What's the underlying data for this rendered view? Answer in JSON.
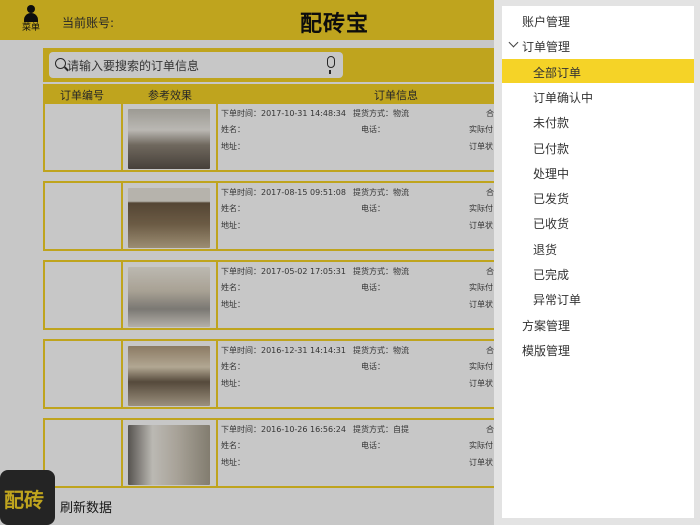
{
  "header": {
    "menu_label": "菜单",
    "account_label": "当前账号:",
    "title": "配砖宝"
  },
  "search": {
    "placeholder": "请输入要搜索的订单信息"
  },
  "table": {
    "col_id": "订单编号",
    "col_preview": "参考效果",
    "col_info": "订单信息"
  },
  "field_labels": {
    "name": "姓名：",
    "phone": "电话：",
    "address": "地址：",
    "amount": "实际付",
    "status": "订单状",
    "total": "合"
  },
  "orders": [
    {
      "time": "下单时间：2017-10-31 14:48:34",
      "pickup": "提货方式：物流",
      "image": "room-photo-1"
    },
    {
      "time": "下单时间：2017-08-15 09:51:08",
      "pickup": "提货方式：物流",
      "image": "room-photo-2"
    },
    {
      "time": "下单时间：2017-05-02 17:05:31",
      "pickup": "提货方式：物流",
      "image": "room-photo-3"
    },
    {
      "time": "下单时间：2016-12-31 14:14:31",
      "pickup": "提货方式：物流",
      "image": "room-photo-4"
    },
    {
      "time": "下单时间：2016-10-26 16:56:24",
      "pickup": "提货方式：自提",
      "image": "room-photo-5"
    }
  ],
  "footer": {
    "fab_label": "配砖",
    "refresh_label": "刷新数据"
  },
  "drawer": {
    "items": [
      {
        "label": "账户管理"
      },
      {
        "label": "订单管理",
        "expanded": true
      },
      {
        "label": "全部订单",
        "selected": true
      },
      {
        "label": "订单确认中"
      },
      {
        "label": "未付款"
      },
      {
        "label": "已付款"
      },
      {
        "label": "处理中"
      },
      {
        "label": "已发货"
      },
      {
        "label": "已收货"
      },
      {
        "label": "退货"
      },
      {
        "label": "已完成"
      },
      {
        "label": "异常订单"
      },
      {
        "label": "方案管理"
      },
      {
        "label": "模版管理"
      }
    ]
  },
  "colors": {
    "accent": "#f5d327",
    "overlay": "rgba(0,0,0,0.22)",
    "fab_bg": "#2f2f2f"
  }
}
